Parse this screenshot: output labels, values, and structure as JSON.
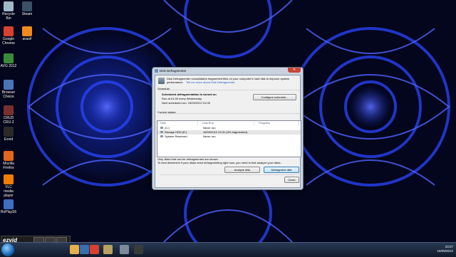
{
  "desktop_icons": [
    {
      "name": "recycle-bin",
      "label": "Recycle Bin",
      "color": "#9fb7c9"
    },
    {
      "name": "steam",
      "label": "Steam",
      "color": "#3b4f66"
    },
    {
      "name": "google-chrome",
      "label": "Google Chrome",
      "color": "#d8412f"
    },
    {
      "name": "avast",
      "label": "avast!",
      "color": "#f08a1c"
    },
    {
      "name": "avg-2012",
      "label": "AVG 2012",
      "color": "#3a8a3a"
    },
    {
      "name": "browser-choice",
      "label": "Browser Choice",
      "color": "#4b74b8"
    },
    {
      "name": "crud-cru-2",
      "label": "CRUD CRU-2",
      "color": "#7a2f2f"
    },
    {
      "name": "ezvid",
      "label": "Ezvid",
      "color": "#2a2a2a"
    },
    {
      "name": "mozilla-firefox",
      "label": "Mozilla Firefox",
      "color": "#e2671e"
    },
    {
      "name": "vlc-media-player",
      "label": "VLC media player",
      "color": "#f07d00"
    },
    {
      "name": "roblox",
      "label": "RoPlayS6",
      "color": "#3c6fbf"
    }
  ],
  "window": {
    "title": "Disk Defragmenter",
    "close_glyph": "✕",
    "intro": "Disk Defragmenter consolidates fragmented files on your computer's hard disk to improve system",
    "intro2": "performance.",
    "intro_link": "Tell me more about Disk Defragmenter.",
    "schedule_header": "Schedule:",
    "schedule_on": "Scheduled defragmentation is turned on",
    "run_at": "Run at 01:00 every Wednesday",
    "next_run": "Next scheduled run: 19/09/2012 01:05",
    "configure_button": "Configure schedule...",
    "current_status_header": "Current status:",
    "columns": [
      "Disk",
      "Last Run",
      "Progress"
    ],
    "disks": [
      {
        "disk": "(C:)",
        "last_run": "Never run",
        "progress": ""
      },
      {
        "disk": "Storage HDD (E:)",
        "last_run": "16/09/2012 23:31 (0% fragmented)",
        "progress": ""
      },
      {
        "disk": "System Reserved",
        "last_run": "Never run",
        "progress": ""
      }
    ],
    "footnote1": "Only disks that can be defragmented are shown.",
    "footnote2": "To best determine if your disks need defragmenting right now, you need to first analyze your disks.",
    "analyze_button": "Analyze disk",
    "defrag_button": "Defragment disk",
    "close_button": "Close"
  },
  "ezvid": {
    "logo": "ezvid",
    "sub": "RECORDER",
    "buttons": [
      "RECORD",
      "STOP",
      "CANCEL"
    ]
  },
  "tray": {
    "time": "23:27",
    "date": "16/09/2012"
  }
}
